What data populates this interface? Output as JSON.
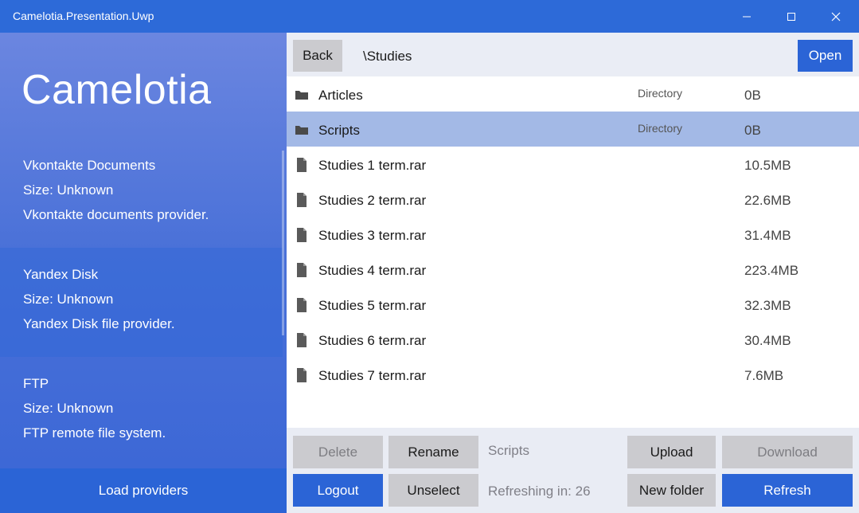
{
  "window": {
    "title": "Camelotia.Presentation.Uwp"
  },
  "sidebar": {
    "app_name": "Camelotia",
    "providers": [
      {
        "name": "Vkontakte Documents",
        "size": "Size: Unknown",
        "description": "Vkontakte documents provider."
      },
      {
        "name": "Yandex Disk",
        "size": "Size: Unknown",
        "description": "Yandex Disk file provider."
      },
      {
        "name": "FTP",
        "size": "Size: Unknown",
        "description": "FTP remote file system."
      }
    ],
    "load_label": "Load providers"
  },
  "toolbar": {
    "back_label": "Back",
    "path": "\\Studies",
    "open_label": "Open"
  },
  "files": [
    {
      "name": "Articles",
      "type": "Directory",
      "size": "0B",
      "icon": "folder-icon"
    },
    {
      "name": "Scripts",
      "type": "Directory",
      "size": "0B",
      "icon": "folder-icon"
    },
    {
      "name": "Studies 1 term.rar",
      "type": "",
      "size": "10.5MB",
      "icon": "file-icon"
    },
    {
      "name": "Studies 2 term.rar",
      "type": "",
      "size": "22.6MB",
      "icon": "file-icon"
    },
    {
      "name": "Studies 3 term.rar",
      "type": "",
      "size": "31.4MB",
      "icon": "file-icon"
    },
    {
      "name": "Studies 4 term.rar",
      "type": "",
      "size": "223.4MB",
      "icon": "file-icon"
    },
    {
      "name": "Studies 5 term.rar",
      "type": "",
      "size": "32.3MB",
      "icon": "file-icon"
    },
    {
      "name": "Studies 6 term.rar",
      "type": "",
      "size": "30.4MB",
      "icon": "file-icon"
    },
    {
      "name": "Studies 7 term.rar",
      "type": "",
      "size": "7.6MB",
      "icon": "file-icon"
    }
  ],
  "selected_file": "Scripts",
  "actions": {
    "delete_label": "Delete",
    "rename_label": "Rename",
    "upload_label": "Upload",
    "download_label": "Download",
    "logout_label": "Logout",
    "unselect_label": "Unselect",
    "new_folder_label": "New folder",
    "refresh_label": "Refresh"
  },
  "status": {
    "selected": "Scripts",
    "refreshing": "Refreshing in: 26"
  },
  "colors": {
    "accent": "#2b64d6",
    "title_bar": "#2d6ad8",
    "selection": "#a3b9e6"
  }
}
